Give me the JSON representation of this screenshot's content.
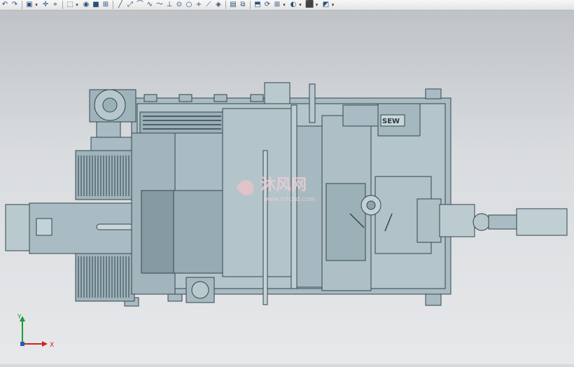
{
  "toolbar": {
    "icons": [
      {
        "name": "undo-icon",
        "glyph": "↶",
        "dd": false
      },
      {
        "name": "redo-icon",
        "glyph": "↷",
        "dd": false
      },
      {
        "name": "select-filter-icon",
        "glyph": "▣",
        "dd": true
      },
      {
        "name": "snap-point-icon",
        "glyph": "✛",
        "dd": false
      },
      {
        "name": "point-on-curve-icon",
        "glyph": "⌖",
        "dd": false
      },
      {
        "name": "select-box-icon",
        "glyph": "⬚",
        "dd": true
      },
      {
        "name": "render-style-icon",
        "glyph": "◉",
        "dd": false
      },
      {
        "name": "solid-view-icon",
        "glyph": "■",
        "dd": false
      },
      {
        "name": "fit-view-icon",
        "glyph": "⊞",
        "dd": false
      },
      {
        "name": "line-icon",
        "glyph": "╱",
        "dd": false
      },
      {
        "name": "arc-tool-icon",
        "glyph": "⤢",
        "dd": false
      },
      {
        "name": "curve-icon",
        "glyph": "⌒",
        "dd": false
      },
      {
        "name": "spline-icon",
        "glyph": "∿",
        "dd": false
      },
      {
        "name": "sketch-curve-icon",
        "glyph": "〜",
        "dd": false
      },
      {
        "name": "perpendicular-icon",
        "glyph": "⊥",
        "dd": false
      },
      {
        "name": "circle-center-icon",
        "glyph": "⊙",
        "dd": false
      },
      {
        "name": "circle-icon",
        "glyph": "○",
        "dd": false
      },
      {
        "name": "point-cross-icon",
        "glyph": "+",
        "dd": false
      },
      {
        "name": "dimension-icon",
        "glyph": "⟋",
        "dd": false
      },
      {
        "name": "face-select-icon",
        "glyph": "◈",
        "dd": false
      },
      {
        "name": "layer-icon",
        "glyph": "▤",
        "dd": false
      },
      {
        "name": "view-box-icon",
        "glyph": "⧉",
        "dd": false
      },
      {
        "name": "edit-section-icon",
        "glyph": "⬒",
        "dd": false
      },
      {
        "name": "rotate-view-icon",
        "glyph": "⟳",
        "dd": false
      },
      {
        "name": "grid-icon",
        "glyph": "⊞",
        "dd": true
      },
      {
        "name": "shading-icon",
        "glyph": "◐",
        "dd": true
      },
      {
        "name": "cube-view-icon",
        "glyph": "⬛",
        "dd": true
      },
      {
        "name": "display-mode-icon",
        "glyph": "◩",
        "dd": true
      }
    ],
    "separators_after": [
      1,
      4,
      8,
      19,
      21
    ]
  },
  "viewport": {
    "model": "machine-assembly-top-view",
    "motor_badge": "SEW",
    "watermark": "沐风网",
    "watermark_url": "www.mfcad.com"
  },
  "triad": {
    "x_label": "X",
    "y_label": "Y"
  },
  "colors": {
    "part": "#a9bcc3",
    "part_dark": "#8da1a9",
    "edge": "#34464d",
    "axis_x": "#d42020",
    "axis_y": "#1e9a3a"
  }
}
